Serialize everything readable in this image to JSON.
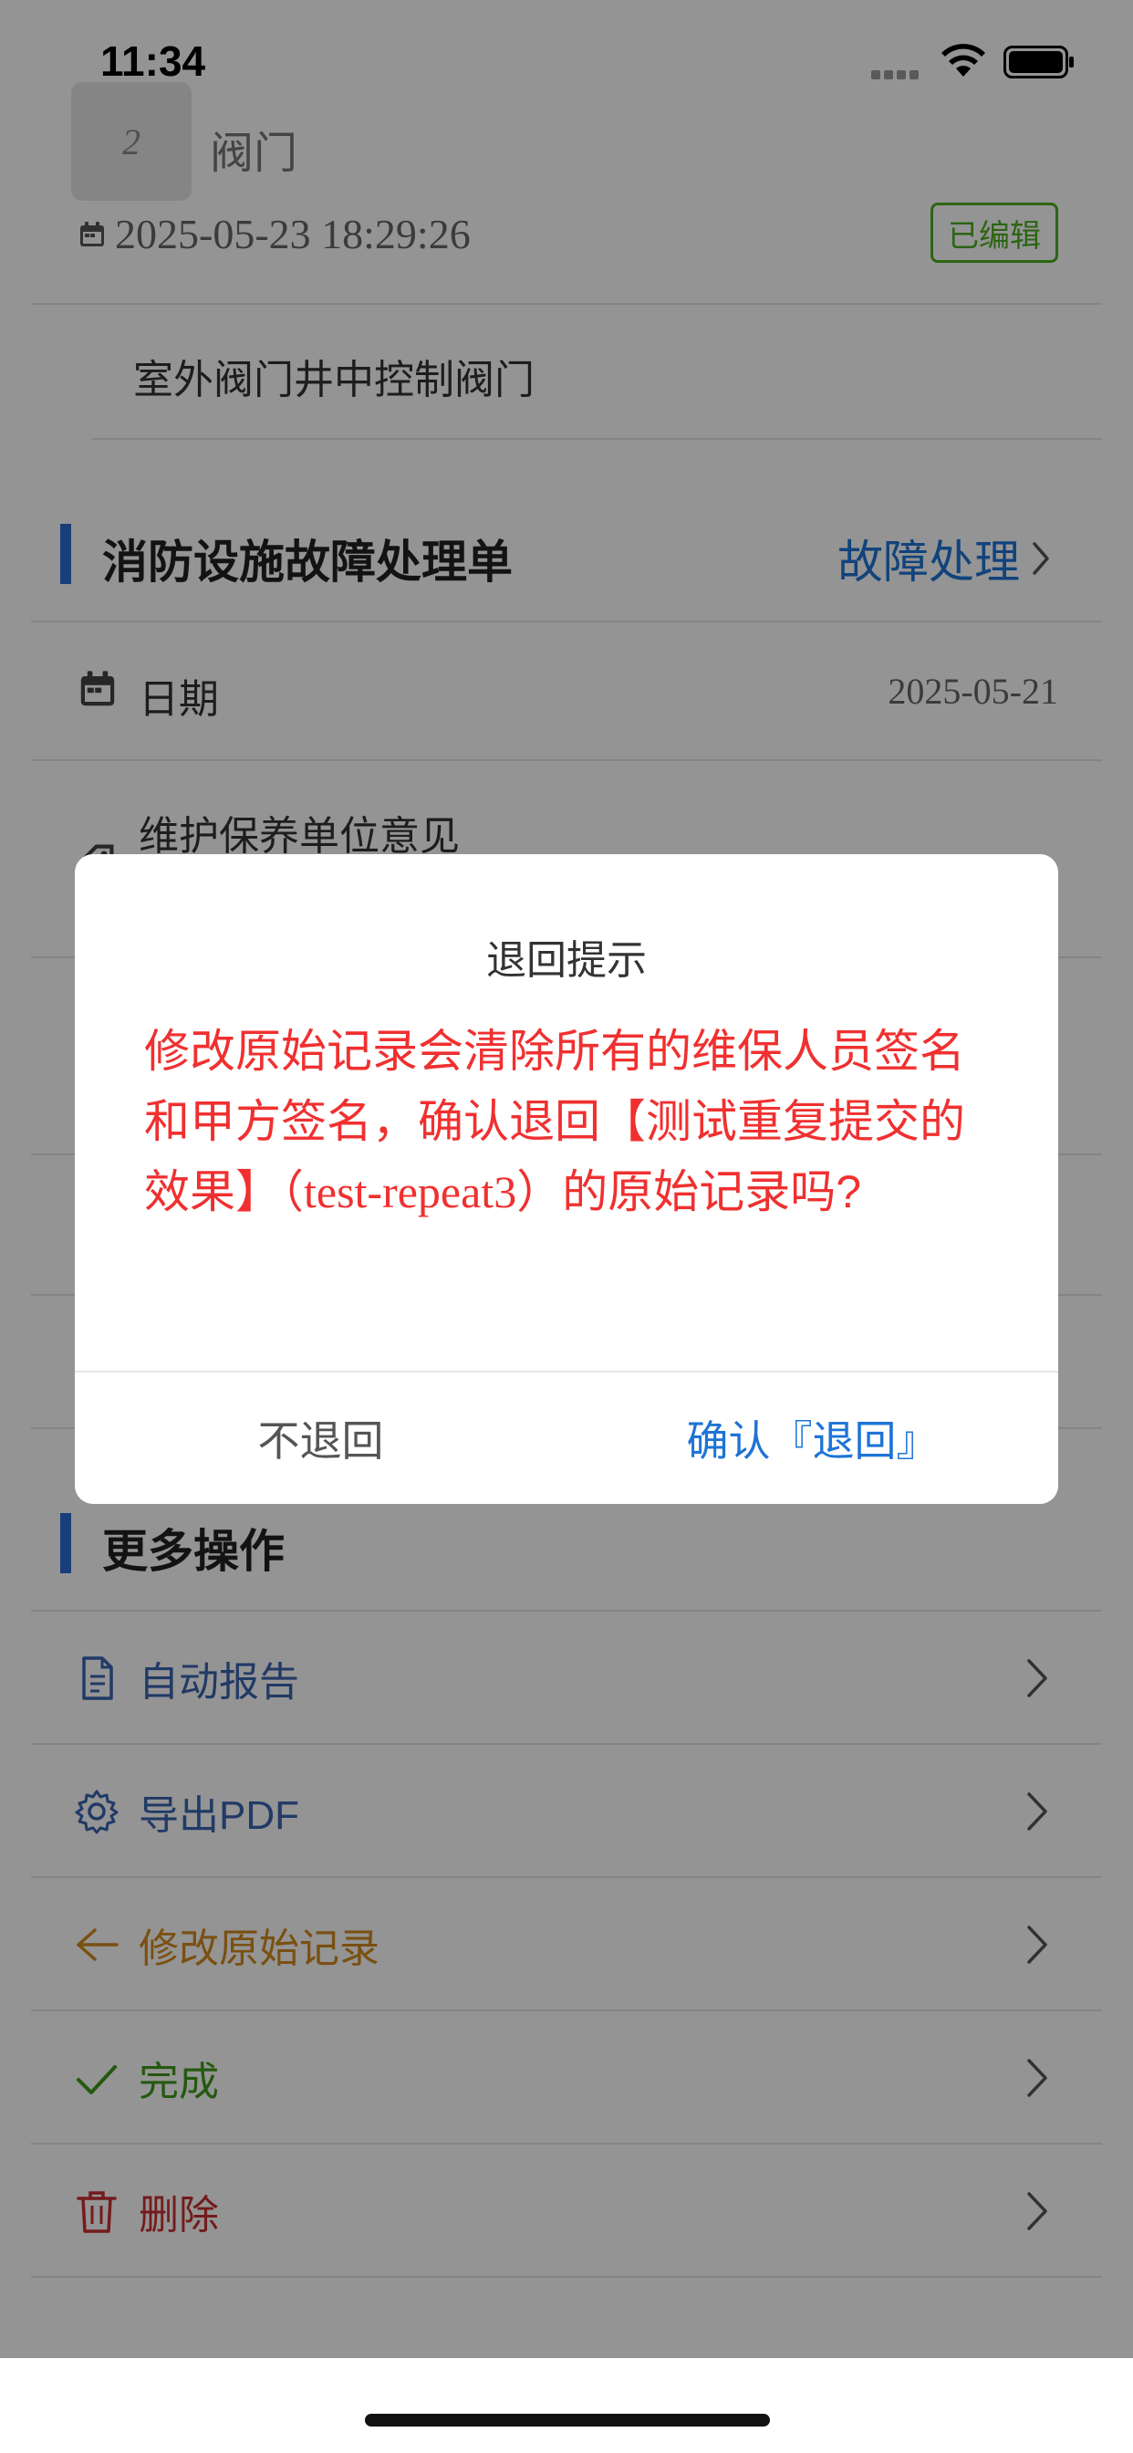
{
  "status_bar": {
    "time": "11:34"
  },
  "valve": {
    "thumb_number": "2",
    "title": "阀门",
    "datetime": "2025-05-23 18:29:26",
    "badge": "已编辑",
    "description": "室外阀门井中控制阀门"
  },
  "fault_section": {
    "title": "消防设施故障处理单",
    "link_label": "故障处理",
    "fields": [
      {
        "label": "日期",
        "value": "2025-05-21"
      },
      {
        "label": "维护保养单位意见"
      }
    ]
  },
  "more_section": {
    "title": "更多操作",
    "actions": [
      {
        "label": "自动报告",
        "color": "#3a64b0"
      },
      {
        "label": "导出PDF",
        "color": "#3a64b0"
      },
      {
        "label": "修改原始记录",
        "color": "#d28a1e"
      },
      {
        "label": "完成",
        "color": "#3f9a1a"
      },
      {
        "label": "删除",
        "color": "#c83030"
      }
    ]
  },
  "dialog": {
    "title": "退回提示",
    "message_part1": "修改原始记录会清除所有的维保人员签名和甲方签名，确认退回【测试重复提交的效果】（",
    "message_code": "test-repeat3",
    "message_part2": "）的原始记录吗?",
    "cancel_label": "不退回",
    "confirm_label": "确认『退回』"
  },
  "colors": {
    "accent_blue": "#1e74d6",
    "danger_red": "#f03030",
    "success_green": "#4caf22"
  }
}
